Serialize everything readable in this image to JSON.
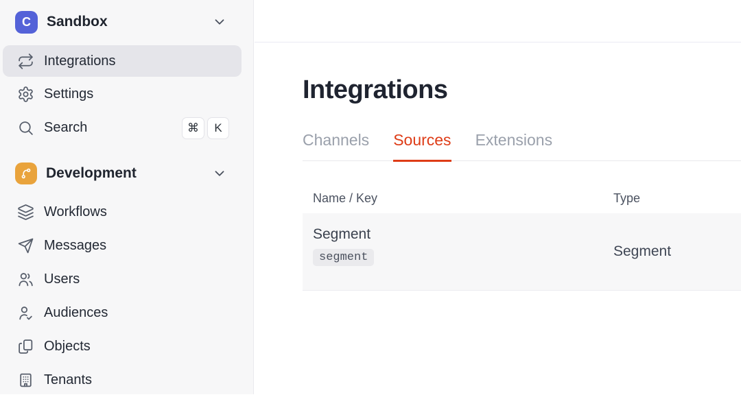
{
  "colors": {
    "accent_red": "#de3c17",
    "brand_indigo": "#5462d8",
    "development_orange": "#e9a33c",
    "sidebar_bg": "#f7f7f8",
    "active_item_bg": "#e5e5ea",
    "row_bg": "#f7f7f8",
    "key_badge_bg": "#eaeaed"
  },
  "sidebar": {
    "workspace": {
      "name": "Sandbox",
      "logo_letter": "C"
    },
    "nav": [
      {
        "label": "Integrations"
      },
      {
        "label": "Settings"
      },
      {
        "label": "Search",
        "shortcut_keys": [
          "⌘",
          "K"
        ]
      }
    ],
    "section": {
      "name": "Development"
    },
    "section_nav": [
      {
        "label": "Workflows"
      },
      {
        "label": "Messages"
      },
      {
        "label": "Users"
      },
      {
        "label": "Audiences"
      },
      {
        "label": "Objects"
      },
      {
        "label": "Tenants"
      }
    ]
  },
  "main": {
    "page_title": "Integrations",
    "tabs": [
      {
        "label": "Channels"
      },
      {
        "label": "Sources"
      },
      {
        "label": "Extensions"
      }
    ],
    "table": {
      "columns": [
        "Name / Key",
        "Type"
      ],
      "rows": [
        {
          "name": "Segment",
          "key": "segment",
          "type": "Segment"
        }
      ]
    }
  },
  "icons": {
    "workspace_logo": "indigo-squircle-C",
    "integrations": "repeat-arrows",
    "settings": "gear",
    "search": "magnifier",
    "development": "branch-on-orange-squircle",
    "workflows": "layers",
    "messages": "paper-plane",
    "users": "two-people",
    "audiences": "person-check",
    "objects": "copy-documents",
    "tenants": "building",
    "expand": "chevron-down"
  }
}
